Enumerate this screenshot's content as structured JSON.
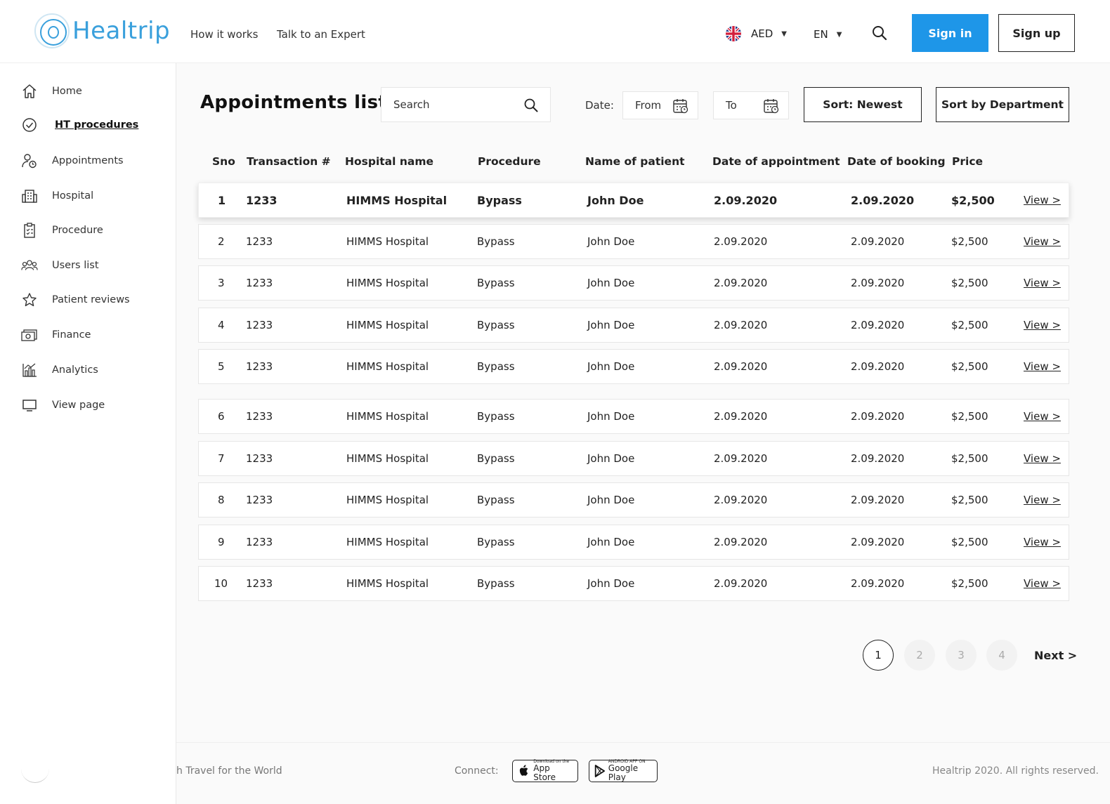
{
  "brand": {
    "name": "Healtrip",
    "accent": "#1e96e8"
  },
  "nav": {
    "how_it_works": "How it works",
    "talk_expert": "Talk to an Expert"
  },
  "currency": {
    "value": "AED",
    "flag": "uk-flag-icon"
  },
  "language": {
    "value": "EN"
  },
  "auth": {
    "sign_in": "Sign in",
    "sign_up": "Sign up"
  },
  "sidebar": {
    "items": [
      {
        "label": "Home",
        "icon": "home-icon"
      },
      {
        "label": "HT procedures",
        "icon": "check-circle-icon",
        "active": true
      },
      {
        "label": "Appointments",
        "icon": "user-clock-icon"
      },
      {
        "label": "Hospital",
        "icon": "building-icon"
      },
      {
        "label": "Procedure",
        "icon": "clipboard-icon"
      },
      {
        "label": "Users list",
        "icon": "users-icon"
      },
      {
        "label": "Patient reviews",
        "icon": "star-icon"
      },
      {
        "label": "Finance",
        "icon": "money-icon"
      },
      {
        "label": "Analytics",
        "icon": "chart-icon"
      },
      {
        "label": "View page",
        "icon": "monitor-icon"
      }
    ]
  },
  "page": {
    "title": "Appointments list",
    "search_placeholder": "Search",
    "date_label": "Date:",
    "date_from": "From",
    "date_to": "To",
    "sort_newest": "Sort: Newest",
    "sort_department": "Sort by Department"
  },
  "table": {
    "headers": [
      "Sno",
      "Transaction #",
      "Hospital name",
      "Procedure",
      "Name of patient",
      "Date of appointment",
      "Date of booking",
      "Price"
    ],
    "view_label": "View >",
    "rows": [
      {
        "sno": "1",
        "txn": "1233",
        "hospital": "HIMMS Hospital",
        "procedure": "Bypass",
        "patient": "John Doe",
        "appt": "2.09.2020",
        "booking": "2.09.2020",
        "price": "$2,500"
      },
      {
        "sno": "2",
        "txn": "1233",
        "hospital": "HIMMS Hospital",
        "procedure": "Bypass",
        "patient": "John Doe",
        "appt": "2.09.2020",
        "booking": "2.09.2020",
        "price": "$2,500"
      },
      {
        "sno": "3",
        "txn": "1233",
        "hospital": "HIMMS Hospital",
        "procedure": "Bypass",
        "patient": "John Doe",
        "appt": "2.09.2020",
        "booking": "2.09.2020",
        "price": "$2,500"
      },
      {
        "sno": "4",
        "txn": "1233",
        "hospital": "HIMMS Hospital",
        "procedure": "Bypass",
        "patient": "John Doe",
        "appt": "2.09.2020",
        "booking": "2.09.2020",
        "price": "$2,500"
      },
      {
        "sno": "5",
        "txn": "1233",
        "hospital": "HIMMS Hospital",
        "procedure": "Bypass",
        "patient": "John Doe",
        "appt": "2.09.2020",
        "booking": "2.09.2020",
        "price": "$2,500"
      },
      {
        "sno": "6",
        "txn": "1233",
        "hospital": "HIMMS Hospital",
        "procedure": "Bypass",
        "patient": "John Doe",
        "appt": "2.09.2020",
        "booking": "2.09.2020",
        "price": "$2,500"
      },
      {
        "sno": "7",
        "txn": "1233",
        "hospital": "HIMMS Hospital",
        "procedure": "Bypass",
        "patient": "John Doe",
        "appt": "2.09.2020",
        "booking": "2.09.2020",
        "price": "$2,500"
      },
      {
        "sno": "8",
        "txn": "1233",
        "hospital": "HIMMS Hospital",
        "procedure": "Bypass",
        "patient": "John Doe",
        "appt": "2.09.2020",
        "booking": "2.09.2020",
        "price": "$2,500"
      },
      {
        "sno": "9",
        "txn": "1233",
        "hospital": "HIMMS Hospital",
        "procedure": "Bypass",
        "patient": "John Doe",
        "appt": "2.09.2020",
        "booking": "2.09.2020",
        "price": "$2,500"
      },
      {
        "sno": "10",
        "txn": "1233",
        "hospital": "HIMMS Hospital",
        "procedure": "Bypass",
        "patient": "John Doe",
        "appt": "2.09.2020",
        "booking": "2.09.2020",
        "price": "$2,500"
      }
    ]
  },
  "pagination": {
    "pages": [
      "1",
      "2",
      "3",
      "4"
    ],
    "current": "1",
    "next": "Next >"
  },
  "footer": {
    "tagline": "h Travel for the World",
    "connect": "Connect:",
    "app_store_small": "Download on the",
    "app_store": "App Store",
    "google_small": "ANDROID APP ON",
    "google": "Google Play",
    "copyright": "Healtrip 2020. All rights reserved."
  }
}
